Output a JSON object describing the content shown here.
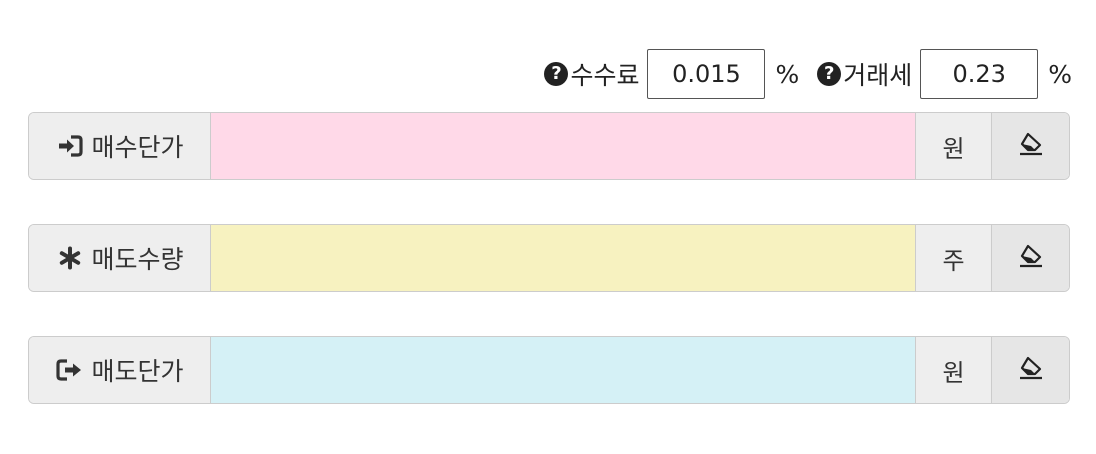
{
  "fees": {
    "commission": {
      "icon": "question-circle-icon",
      "label": "수수료",
      "value": "0.015",
      "unit": "%"
    },
    "transaction_tax": {
      "icon": "question-circle-icon",
      "label": "거래세",
      "value": "0.23",
      "unit": "%"
    }
  },
  "rows": [
    {
      "icon": "sign-in-icon",
      "label": "매수단가",
      "value": "",
      "input_color": "#ffd9e8",
      "unit": "원",
      "clear_icon": "eraser-icon"
    },
    {
      "icon": "asterisk-icon",
      "label": "매도수량",
      "value": "",
      "input_color": "#f7f2c0",
      "unit": "주",
      "clear_icon": "eraser-icon"
    },
    {
      "icon": "sign-out-icon",
      "label": "매도단가",
      "value": "",
      "input_color": "#d5f1f6",
      "unit": "원",
      "clear_icon": "eraser-icon"
    }
  ]
}
